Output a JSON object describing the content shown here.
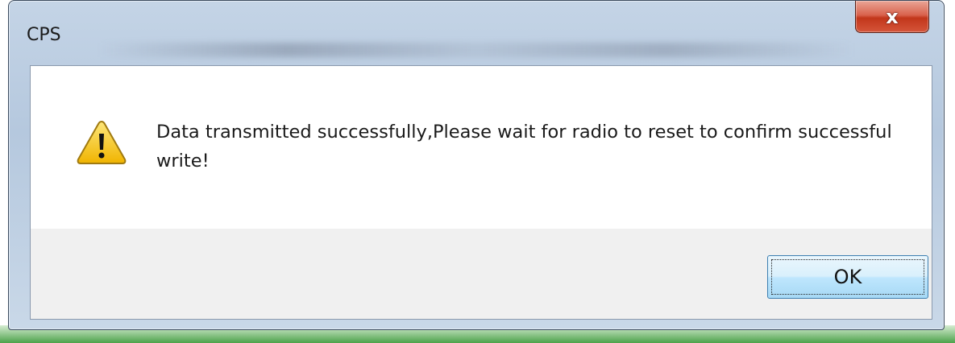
{
  "window": {
    "title": "CPS",
    "close_glyph": "x",
    "close_icon": "close-icon"
  },
  "dialog": {
    "icon": "warning-icon",
    "message": "Data transmitted successfully,Please wait for radio to reset to confirm successful write!",
    "ok_label": "OK"
  },
  "colors": {
    "warning_fill": "#f5c518",
    "close_button": "#c2361b",
    "ok_button_border": "#3c7fb1",
    "taskbar_green": "#4ca24a"
  }
}
